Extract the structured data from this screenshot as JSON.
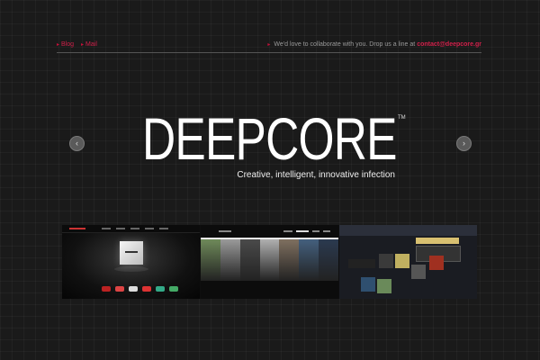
{
  "topbar": {
    "blog_label": "Blog",
    "mail_label": "Mail",
    "message": "We'd love to collaborate with you. Drop us a line at",
    "contact_email": "contact@deepcore.gr",
    "bullet": "▸"
  },
  "hero": {
    "logo": "DEEPCORE",
    "trademark": "TM",
    "tagline": "Creative, intelligent, innovative infection",
    "prev_icon": "‹",
    "next_icon": "›"
  },
  "colors": {
    "accent": "#d0204a",
    "background": "#1a1a1a",
    "text": "#ffffff"
  },
  "thumbnails": {
    "thumb2_photos": [
      "#6f8a5a",
      "#9a9a9a",
      "#4a4a4a",
      "#b0b0b0",
      "#7f7060",
      "#44607e",
      "#2b3a50"
    ],
    "thumb3_squares": [
      "#3a3a3a",
      "#c0b060",
      "#555",
      "#a03020",
      "#2f4f6f",
      "#6a8a5a"
    ],
    "thumb1_logos": [
      "#b22",
      "#d44",
      "#ddd",
      "#d33",
      "#3a8",
      "#4a6"
    ]
  }
}
